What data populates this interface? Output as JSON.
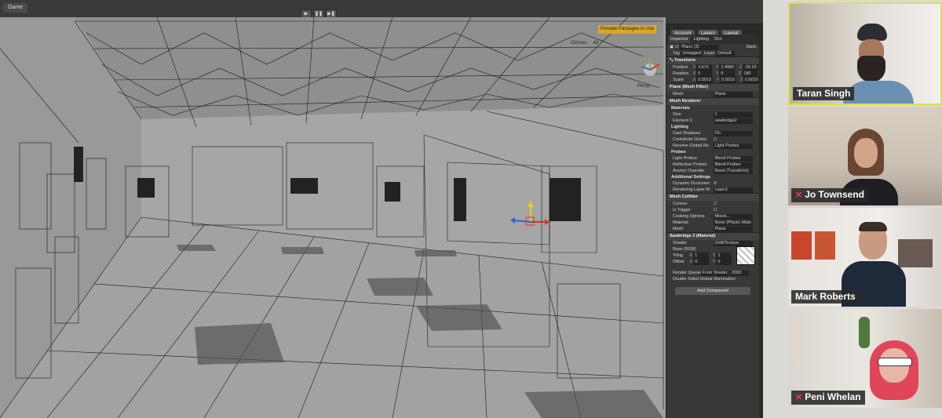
{
  "editor": {
    "game_tab": "Game",
    "preview_packages": "Preview Packages in Use",
    "menus": [
      "Account",
      "Layers",
      "Layout"
    ],
    "gizmos_label": "Gizmos",
    "all_label": "All",
    "persp_label": "Persp",
    "play_icons": [
      "play-icon",
      "pause-icon",
      "step-icon"
    ]
  },
  "inspector": {
    "tabs": [
      "Inspector",
      "Lighting",
      "Occ"
    ],
    "object_name": "Plane (3)",
    "static_label": "Static",
    "tag_label": "Tag",
    "tag_value": "Untagged",
    "layer_label": "Layer",
    "layer_value": "Default",
    "transform": {
      "header": "Transform",
      "position_label": "Position",
      "position": [
        "3.671",
        "2.4983",
        "-26.03"
      ],
      "rotation_label": "Rotation",
      "rotation": [
        "0",
        "0",
        "180"
      ],
      "scale_label": "Scale",
      "scale": [
        "0.5015",
        "0.5015",
        "0.5015"
      ]
    },
    "mesh_filter": {
      "header": "Plane (Mesh Filter)",
      "mesh_label": "Mesh",
      "mesh_value": "Plane"
    },
    "mesh_renderer": {
      "header": "Mesh Renderer",
      "materials_label": "Materials",
      "size_label": "Size",
      "size_value": "1",
      "element_label": "Element 0",
      "element_value": "sawbridge2",
      "lighting_label": "Lighting",
      "cast_shadows_label": "Cast Shadows",
      "cast_shadows_value": "On",
      "contribute_gi_label": "Contribute Global",
      "receive_gi_label": "Receive Global Illu",
      "receive_gi_value": "Light Probes",
      "probes_label": "Probes",
      "light_probes_label": "Light Probes",
      "light_probes_value": "Blend Probes",
      "reflection_probes_label": "Reflection Probes",
      "reflection_probes_value": "Blend Probes",
      "anchor_label": "Anchor Override",
      "anchor_value": "None (Transform)",
      "additional_label": "Additional Settings",
      "dynamic_occlusion_label": "Dynamic Occlusion",
      "rendering_layer_label": "Rendering Layer M",
      "rendering_layer_value": "Layer1"
    },
    "mesh_collider": {
      "header": "Mesh Collider",
      "convex_label": "Convex",
      "trigger_label": "Is Trigger",
      "cooking_label": "Cooking Options",
      "cooking_value": "Mixed...",
      "material_label": "Material",
      "material_value": "None (Physic Mate",
      "mesh_label": "Mesh",
      "mesh_value": "Plane"
    },
    "material": {
      "header": "Sawbridge 2 (Material)",
      "shader_label": "Shader",
      "shader_value": "Unlit/Texture",
      "base_label": "Base (RGB)",
      "tiling_label": "Tiling",
      "tiling": [
        "1",
        "1"
      ],
      "offset_label": "Offset",
      "offset": [
        "0",
        "0"
      ],
      "queue_label": "Render Queue",
      "queue_mode": "From Shader",
      "queue_value": "2000",
      "double_sided_label": "Double Sided Global Illumination"
    },
    "add_component": "Add Component"
  },
  "participants": [
    {
      "name": "Taran Singh",
      "muted": false,
      "highlight": "#d8e14a"
    },
    {
      "name": "Jo Townsend",
      "muted": true
    },
    {
      "name": "Mark Roberts",
      "muted": false
    },
    {
      "name": "Peni Whelan",
      "muted": true
    }
  ]
}
